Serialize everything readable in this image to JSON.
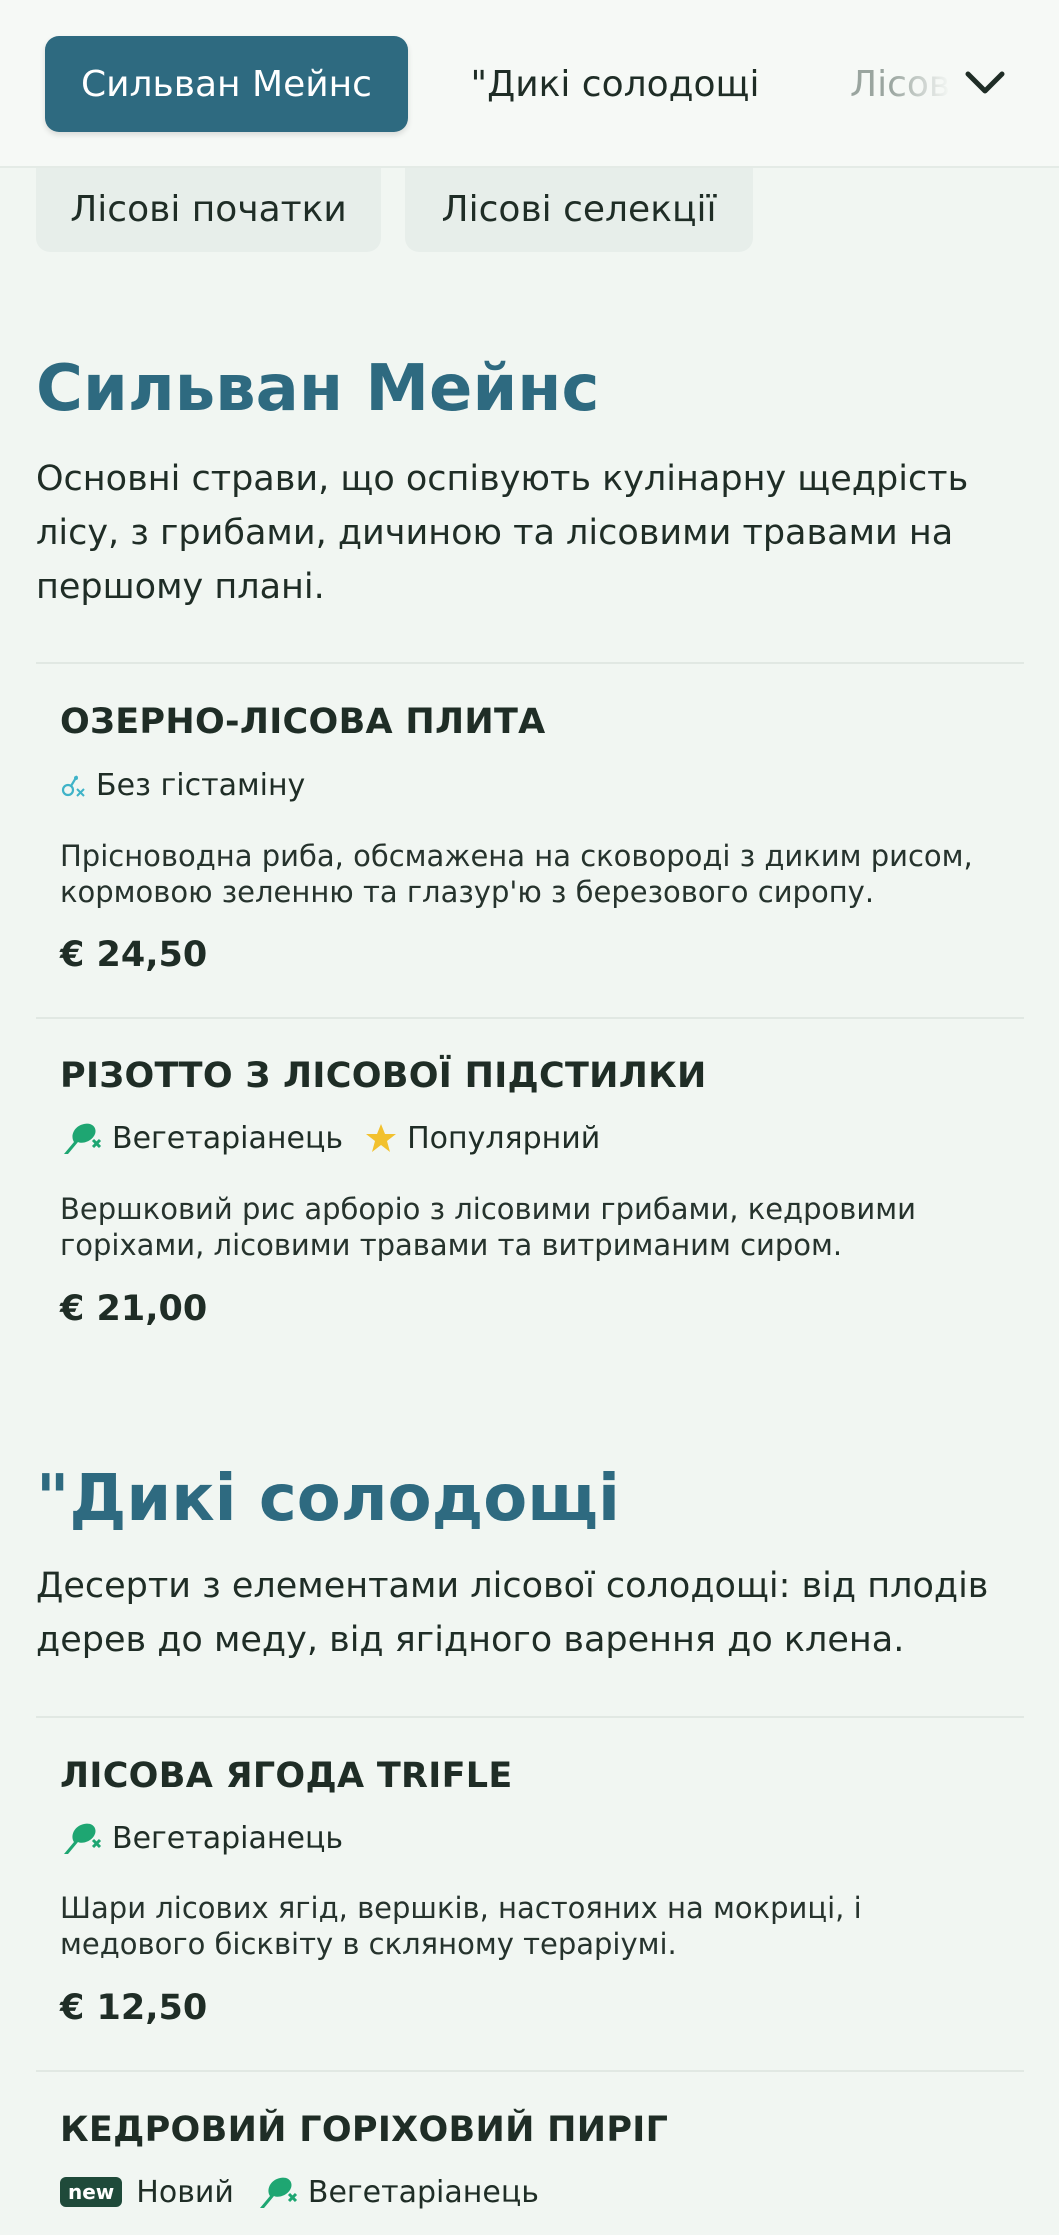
{
  "nav": {
    "tabs": [
      {
        "label": "Сильван Мейнс",
        "active": true
      },
      {
        "label": "\"Дикі солодощі",
        "active": false
      },
      {
        "label": "Лісові",
        "active": false
      }
    ],
    "more_icon": "chevron-down-icon",
    "pills": [
      {
        "label": "Лісові початки"
      },
      {
        "label": "Лісові селекції"
      }
    ]
  },
  "colors": {
    "accent": "#2e6a80",
    "background": "#f1f6f2",
    "vegetarian_icon": "#1ea672",
    "popular_star": "#f2c12e",
    "histamine_icon": "#3fb3c8"
  },
  "sections": [
    {
      "title": "Сильван Мейнс",
      "description": "Основні страви, що оспівують кулінарну щедрість лісу, з грибами, дичиною та лісовими травами на першому плані.",
      "items": [
        {
          "name": "ОЗЕРНО-ЛІСОВА ПЛИТА",
          "tags": [
            {
              "icon": "histamine-free-icon",
              "label": "Без гістаміну"
            }
          ],
          "description": "Прісноводна риба, обсмажена на сковороді з диким рисом, кормовою зеленню та глазур'ю з березового сиропу.",
          "price": "€ 24,50"
        },
        {
          "name": "РІЗОТТО З ЛІСОВОЇ ПІДСТИЛКИ",
          "tags": [
            {
              "icon": "vegetarian-icon",
              "label": "Вегетаріанець"
            },
            {
              "icon": "star-icon",
              "label": "Популярний"
            }
          ],
          "description": "Вершковий рис арборіо з лісовими грибами, кедровими горіхами, лісовими травами та витриманим сиром.",
          "price": "€ 21,00"
        }
      ]
    },
    {
      "title": "\"Дикі солодощі",
      "description": "Десерти з елементами лісової солодощі: від плодів дерев до меду, від ягідного варення до клена.",
      "items": [
        {
          "name": "ЛІСОВА ЯГОДА TRIFLE",
          "tags": [
            {
              "icon": "vegetarian-icon",
              "label": "Вегетаріанець"
            }
          ],
          "description": "Шари лісових ягід, вершків, настояних на мокриці, і медового бісквіту в скляному тераріумі.",
          "price": "€ 12,50"
        },
        {
          "name": "КЕДРОВИЙ ГОРІХОВИЙ ПИРІГ",
          "tags": [
            {
              "badge": "new",
              "label": "Новий"
            },
            {
              "icon": "vegetarian-icon",
              "label": "Вегетаріанець"
            }
          ]
        }
      ]
    }
  ]
}
